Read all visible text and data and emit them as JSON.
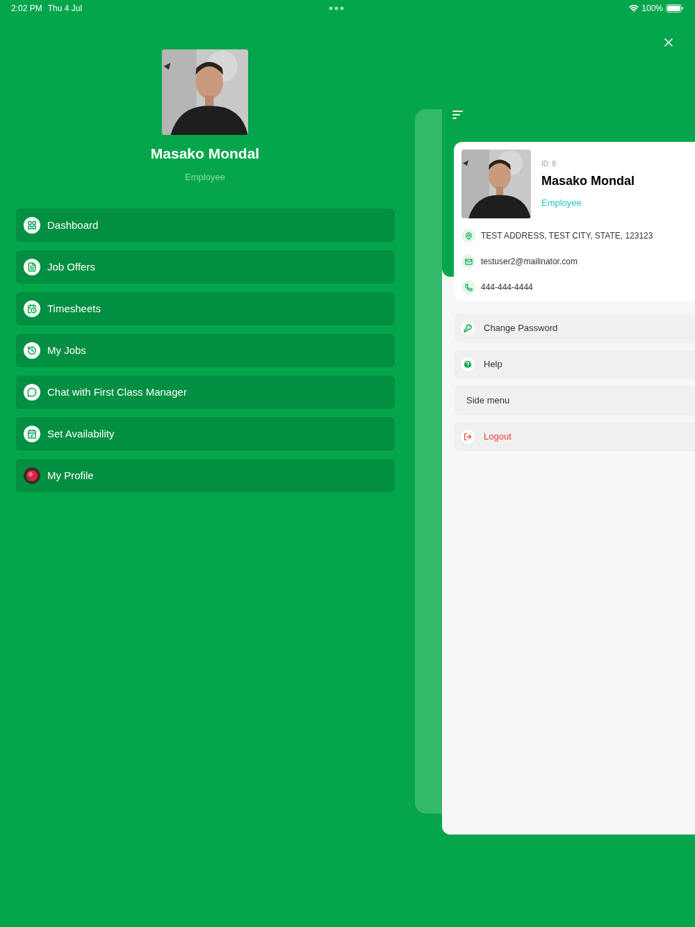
{
  "status_bar": {
    "time": "2:02 PM",
    "date": "Thu 4 Jul",
    "battery": "100%"
  },
  "drawer": {
    "name": "Masako Mondal",
    "role": "Employee",
    "items": [
      {
        "label": "Dashboard",
        "kind": "grid"
      },
      {
        "label": "Job Offers",
        "kind": "document"
      },
      {
        "label": "Timesheets",
        "kind": "timesheet"
      },
      {
        "label": "My Jobs",
        "kind": "history"
      },
      {
        "label": "Chat with First Class Manager",
        "kind": "chat"
      },
      {
        "label": "Set Availability",
        "kind": "calendar"
      },
      {
        "label": "My Profile",
        "kind": "avatar"
      }
    ]
  },
  "profile_card": {
    "id": "ID: 8",
    "name": "Masako Mondal",
    "role": "Employee",
    "details": [
      {
        "text": "TEST ADDRESS, TEST CITY, STATE, 123123",
        "kind": "location"
      },
      {
        "text": "testuser2@mailinator.com",
        "kind": "email"
      },
      {
        "text": "444-444-4444",
        "kind": "phone"
      }
    ]
  },
  "menu": [
    {
      "label": "Change Password",
      "kind": "key"
    },
    {
      "label": "Help",
      "kind": "help"
    },
    {
      "label": "Side menu",
      "kind": "plain"
    },
    {
      "label": "Logout",
      "kind": "logout"
    }
  ]
}
